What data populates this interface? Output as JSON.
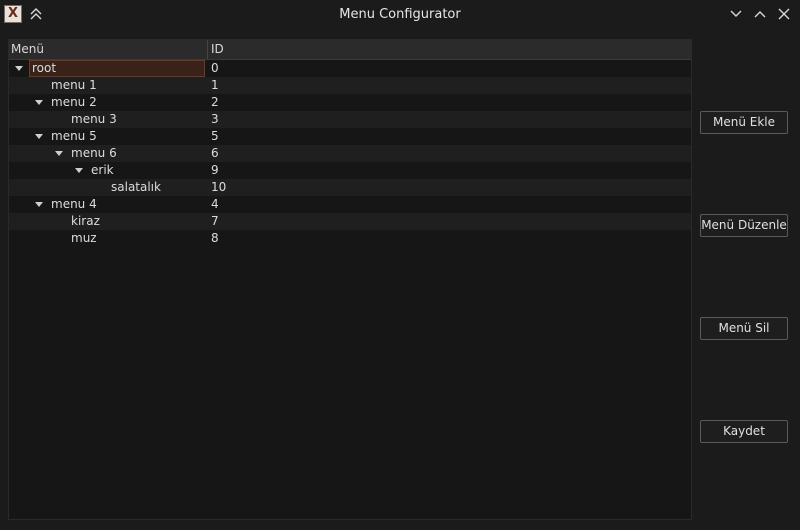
{
  "window": {
    "title": "Menu Configurator",
    "app_icon_glyph": "X"
  },
  "tree": {
    "headers": {
      "menu": "Menü",
      "id": "ID"
    },
    "rows": [
      {
        "label": "root",
        "id": "0",
        "level": 0,
        "expanded": true,
        "selected": true
      },
      {
        "label": "menu 1",
        "id": "1",
        "level": 1,
        "expanded": false,
        "selected": false
      },
      {
        "label": "menu 2",
        "id": "2",
        "level": 1,
        "expanded": true,
        "selected": false
      },
      {
        "label": "menu 3",
        "id": "3",
        "level": 2,
        "expanded": false,
        "selected": false
      },
      {
        "label": "menu 5",
        "id": "5",
        "level": 1,
        "expanded": true,
        "selected": false
      },
      {
        "label": "menu 6",
        "id": "6",
        "level": 2,
        "expanded": true,
        "selected": false
      },
      {
        "label": "erik",
        "id": "9",
        "level": 3,
        "expanded": true,
        "selected": false
      },
      {
        "label": "salatalık",
        "id": "10",
        "level": 4,
        "expanded": false,
        "selected": false
      },
      {
        "label": "menu 4",
        "id": "4",
        "level": 1,
        "expanded": true,
        "selected": false
      },
      {
        "label": "kiraz",
        "id": "7",
        "level": 2,
        "expanded": false,
        "selected": false
      },
      {
        "label": "muz",
        "id": "8",
        "level": 2,
        "expanded": false,
        "selected": false
      }
    ]
  },
  "buttons": {
    "add": "Menü Ekle",
    "edit": "Menü Düzenle",
    "delete": "Menü Sil",
    "save": "Kaydet"
  },
  "colors": {
    "background": "#1b1b1b",
    "selection": "#3a2218"
  }
}
